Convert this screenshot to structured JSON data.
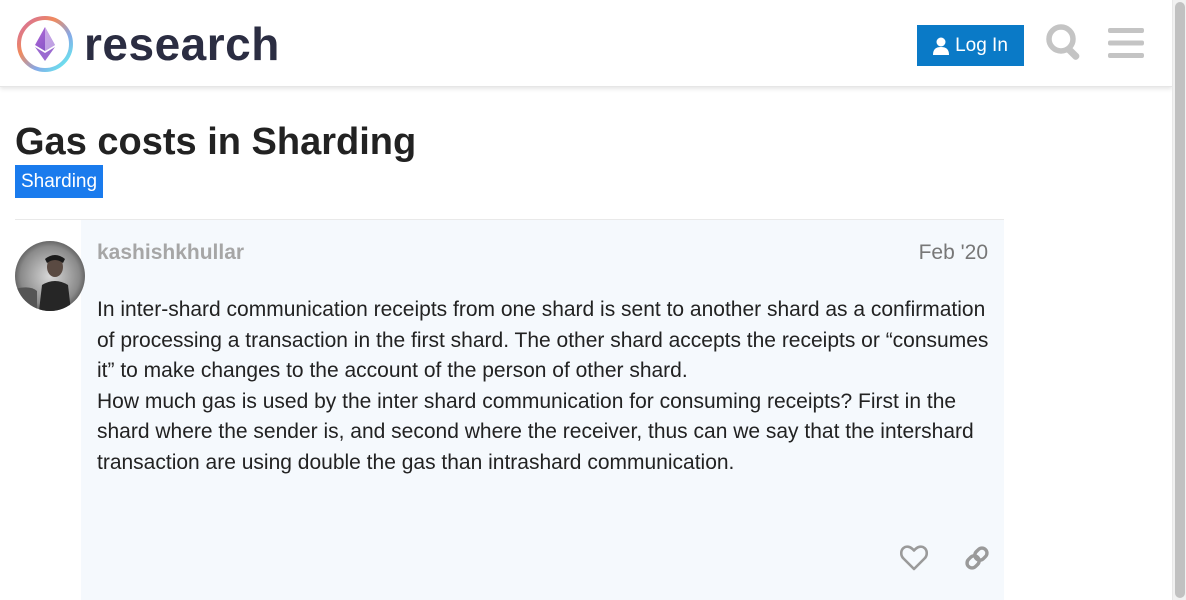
{
  "header": {
    "site_name": "research",
    "login_label": "Log In",
    "icons": [
      "ethereum-logo-icon",
      "user-icon",
      "search-icon",
      "hamburger-menu-icon"
    ]
  },
  "topic": {
    "title": "Gas costs in Sharding",
    "category": "Sharding",
    "category_color": "#1a7bed"
  },
  "post": {
    "username": "kashishkhullar",
    "date": "Feb '20",
    "paragraphs": [
      "In inter-shard communication receipts from one shard is sent to another shard as a confirmation of processing a transaction in the first shard. The other shard accepts the receipts or “consumes it” to make changes to the account of the person of other shard.",
      "How much gas is used by the inter shard communication for consuming receipts? First in the shard where the sender is, and second where the receiver, thus can we say that the intershard transaction are using double the gas than intrashard communication."
    ],
    "actions": [
      "heart-icon",
      "link-icon"
    ]
  },
  "colors": {
    "accent": "#0a7ac7",
    "post_background": "#f5f9fd",
    "icon_gray": "#c4c4c4"
  }
}
